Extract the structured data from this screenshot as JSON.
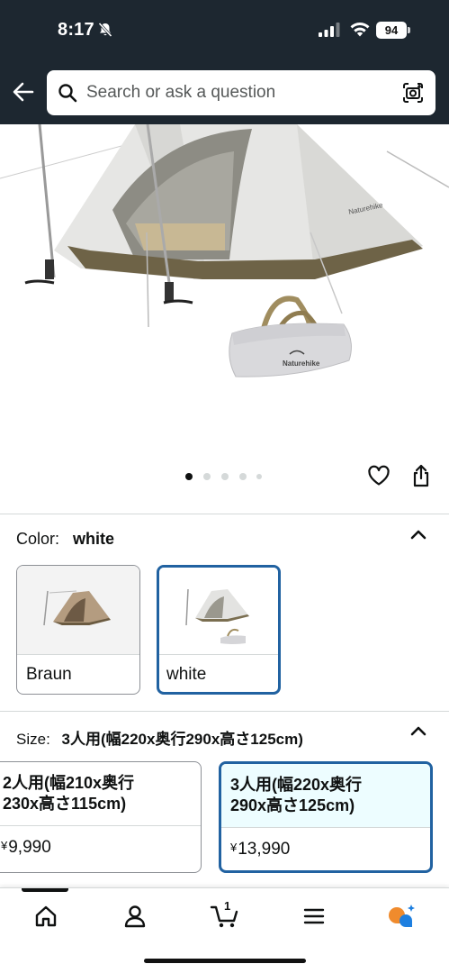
{
  "status": {
    "time": "8:17",
    "battery": "94"
  },
  "search": {
    "placeholder": "Search or ask a question"
  },
  "gallery": {
    "image_count": 5,
    "active_index": 0
  },
  "color": {
    "label": "Color:",
    "selected": "white",
    "options": [
      {
        "name": "Braun",
        "selected": false
      },
      {
        "name": "white",
        "selected": true
      }
    ]
  },
  "size": {
    "label": "Size:",
    "selected": "3人用(幅220x奥行290x高さ125cm)",
    "options": [
      {
        "title_line1": "2人用(幅210x奥行",
        "title_line2": "230x高さ115cm)",
        "currency": "¥",
        "price": "9,990",
        "selected": false
      },
      {
        "title_line1": "3人用(幅220x奥行",
        "title_line2": "290x高さ125cm)",
        "currency": "¥",
        "price": "13,990",
        "selected": true
      }
    ]
  },
  "nav": {
    "items": [
      "home-icon",
      "account-icon",
      "cart-icon",
      "menu-icon",
      "rufus-icon"
    ],
    "cart_count": "1"
  },
  "colors": {
    "header_bg": "#1d2730",
    "selected_border": "#2162a1",
    "selected_bg": "#edfdff",
    "rufus_orange": "#f08b2d",
    "rufus_blue": "#1d7fe0"
  }
}
